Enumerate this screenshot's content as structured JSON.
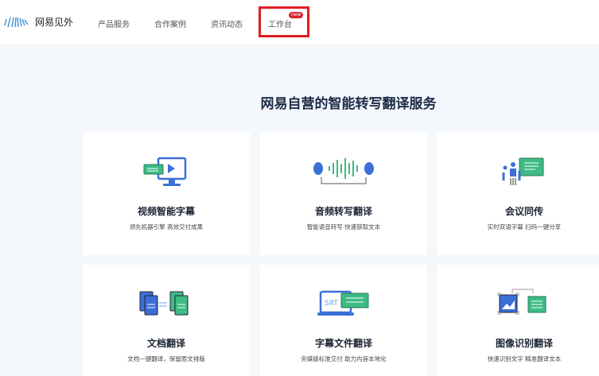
{
  "header": {
    "brand": "网易见外",
    "nav": [
      "产品服务",
      "合作案例",
      "资讯动态",
      "工作台"
    ],
    "badge": "new"
  },
  "main": {
    "title": "网易自营的智能转写翻译服务",
    "cards": [
      {
        "name": "视频智能字幕",
        "desc": "领先机器引擎 高效交付成果",
        "icon": "video-subtitle-icon"
      },
      {
        "name": "音频转写翻译",
        "desc": "智能语音转写 快速获取文本",
        "icon": "audio-headphones-icon"
      },
      {
        "name": "会议同传",
        "desc": "实时双语字幕 扫码一键分享",
        "icon": "meeting-icon"
      },
      {
        "name": "文档翻译",
        "desc": "文档一键翻译，保留原文排版",
        "icon": "document-icon"
      },
      {
        "name": "字幕文件翻译",
        "desc": "央媒级标准交付 助力内容本地化",
        "icon": "srt-file-icon",
        "icon_text": "SRT"
      },
      {
        "name": "图像识别翻译",
        "desc": "快速识别文字 精准翻译文本",
        "icon": "image-ocr-icon"
      }
    ]
  },
  "colors": {
    "blue": "#3b6fd8",
    "green": "#3dbb83",
    "highlight": "#e11b22"
  }
}
